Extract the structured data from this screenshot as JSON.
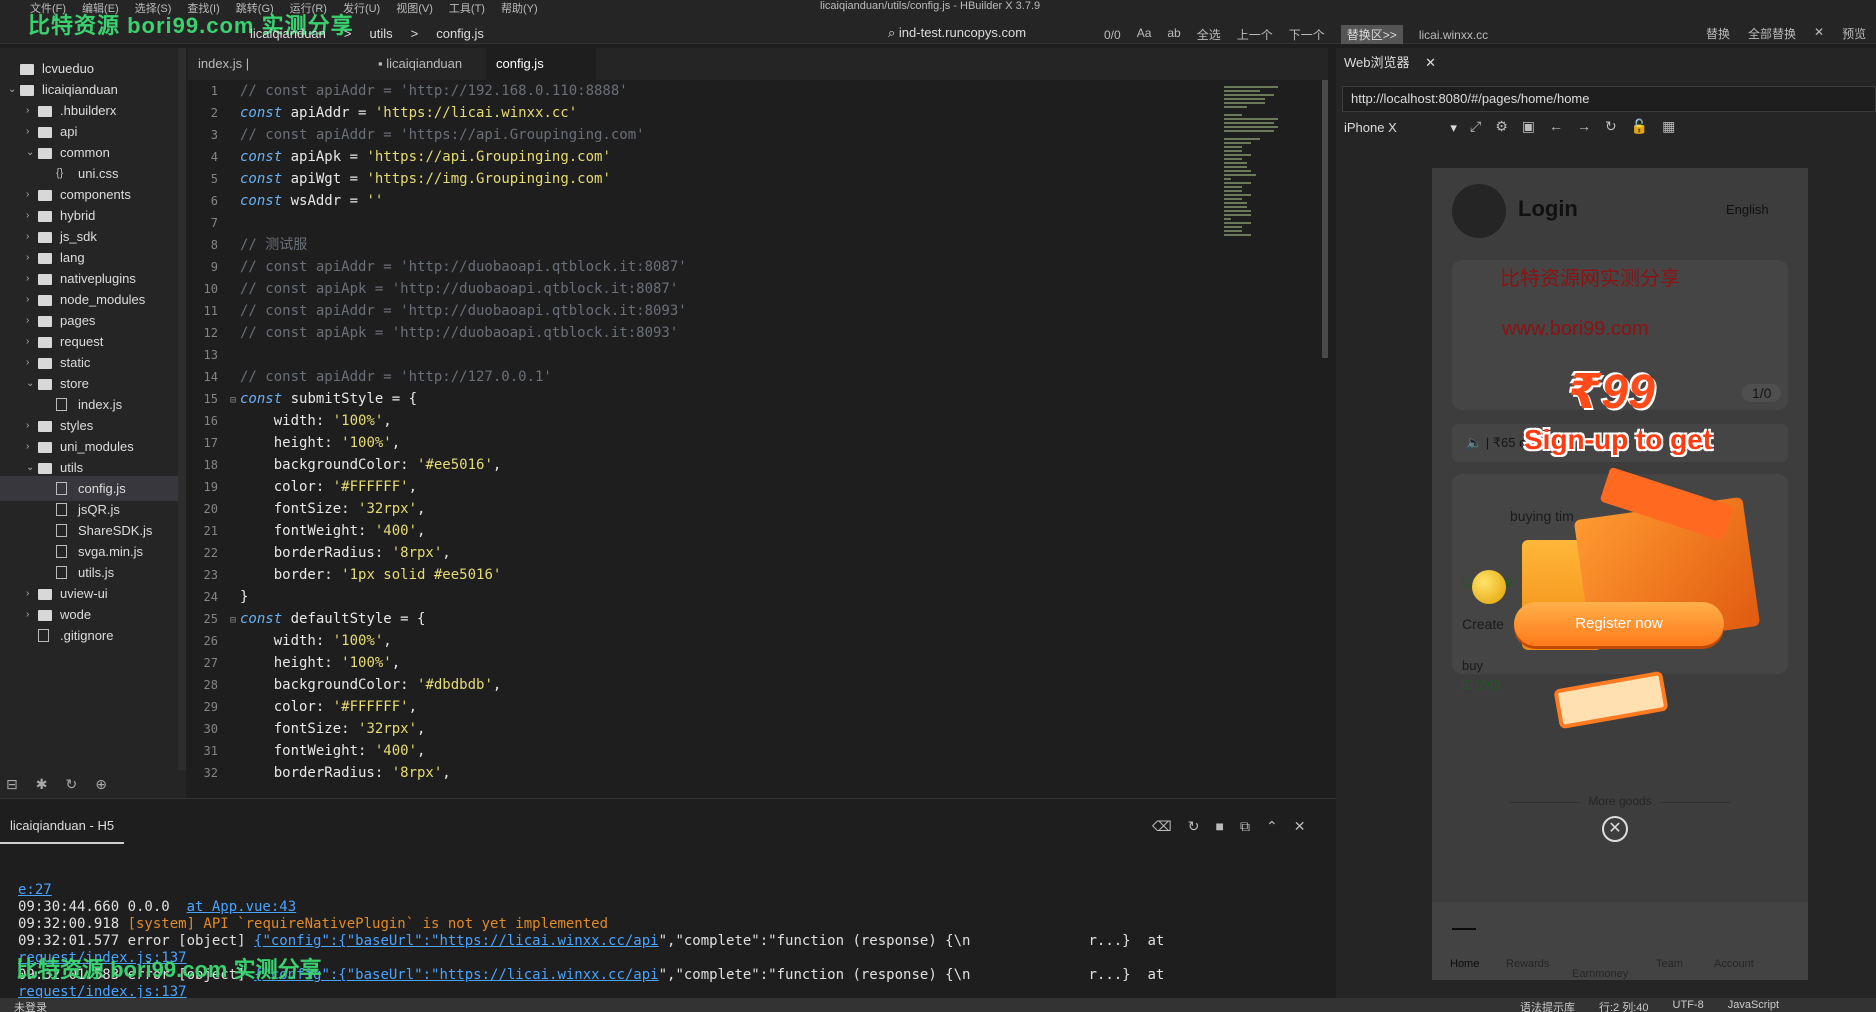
{
  "window": {
    "title": "licaiqianduan/utils/config.js - HBuilder X 3.7.9",
    "menu": [
      "文件(F)",
      "编辑(E)",
      "选择(S)",
      "查找(I)",
      "跳转(G)",
      "运行(R)",
      "发行(U)",
      "视图(V)",
      "工具(T)",
      "帮助(Y)"
    ]
  },
  "watermark": {
    "top": "比特资源 bori99.com 实测分享",
    "bottom": "比特资源 bori99.com 实测分享",
    "phone1": "比特资源网实测分享",
    "phone2": "www.bori99.com"
  },
  "toolbar": {
    "crumb": [
      "licaiqianduan",
      ">",
      "utils",
      ">",
      "config.js"
    ],
    "search_text": "ind-test.runcopys.com",
    "count": "0/0",
    "find_tools": [
      "Aa",
      "ab",
      "全选",
      "上一个",
      "下一个"
    ],
    "replace_tag": "替换区>>",
    "replace_value": "licai.winxx.cc",
    "replace_tools": [
      "替换",
      "全部替换",
      "✕",
      "预览"
    ]
  },
  "sidebar": {
    "items": [
      {
        "label": "lcvueduo",
        "type": "folder",
        "depth": 0,
        "chev": ""
      },
      {
        "label": "licaiqianduan",
        "type": "folder",
        "depth": 0,
        "chev": "⌄"
      },
      {
        "label": ".hbuilderx",
        "type": "folder",
        "depth": 1,
        "chev": "›"
      },
      {
        "label": "api",
        "type": "folder",
        "depth": 1,
        "chev": "›"
      },
      {
        "label": "common",
        "type": "folder",
        "depth": 1,
        "chev": "⌄"
      },
      {
        "label": "uni.css",
        "type": "css",
        "depth": 2,
        "chev": ""
      },
      {
        "label": "components",
        "type": "folder",
        "depth": 1,
        "chev": "›"
      },
      {
        "label": "hybrid",
        "type": "folder",
        "depth": 1,
        "chev": "›"
      },
      {
        "label": "js_sdk",
        "type": "folder",
        "depth": 1,
        "chev": "›"
      },
      {
        "label": "lang",
        "type": "folder",
        "depth": 1,
        "chev": "›"
      },
      {
        "label": "nativeplugins",
        "type": "folder",
        "depth": 1,
        "chev": "›"
      },
      {
        "label": "node_modules",
        "type": "folder",
        "depth": 1,
        "chev": "›"
      },
      {
        "label": "pages",
        "type": "folder",
        "depth": 1,
        "chev": "›"
      },
      {
        "label": "request",
        "type": "folder",
        "depth": 1,
        "chev": "›"
      },
      {
        "label": "static",
        "type": "folder",
        "depth": 1,
        "chev": "›"
      },
      {
        "label": "store",
        "type": "folder",
        "depth": 1,
        "chev": "⌄"
      },
      {
        "label": "index.js",
        "type": "file",
        "depth": 2,
        "chev": ""
      },
      {
        "label": "styles",
        "type": "folder",
        "depth": 1,
        "chev": "›"
      },
      {
        "label": "uni_modules",
        "type": "folder",
        "depth": 1,
        "chev": "›"
      },
      {
        "label": "utils",
        "type": "folder",
        "depth": 1,
        "chev": "⌄"
      },
      {
        "label": "config.js",
        "type": "file",
        "depth": 2,
        "chev": "",
        "active": true
      },
      {
        "label": "jsQR.js",
        "type": "file",
        "depth": 2,
        "chev": ""
      },
      {
        "label": "ShareSDK.js",
        "type": "file",
        "depth": 2,
        "chev": ""
      },
      {
        "label": "svga.min.js",
        "type": "file",
        "depth": 2,
        "chev": ""
      },
      {
        "label": "utils.js",
        "type": "file",
        "depth": 2,
        "chev": ""
      },
      {
        "label": "uview-ui",
        "type": "folder",
        "depth": 1,
        "chev": "›"
      },
      {
        "label": "wode",
        "type": "folder",
        "depth": 1,
        "chev": "›"
      },
      {
        "label": ".gitignore",
        "type": "file",
        "depth": 1,
        "chev": ""
      }
    ]
  },
  "tabs": [
    {
      "label": "index.js | lcvueduo/src/interface",
      "active": false
    },
    {
      "label": "licaiqianduan",
      "active": false
    },
    {
      "label": "config.js",
      "active": true
    }
  ],
  "code": [
    {
      "n": "1",
      "fold": "",
      "parts": [
        [
          "cmt",
          "// const apiAddr = 'http://192.168.0.110:8888'"
        ]
      ]
    },
    {
      "n": "2",
      "fold": "",
      "parts": [
        [
          "kw",
          "const"
        ],
        [
          "var",
          " apiAddr "
        ],
        [
          "op",
          "= "
        ],
        [
          "str",
          "'https://licai.winxx.cc'"
        ]
      ]
    },
    {
      "n": "3",
      "fold": "",
      "parts": [
        [
          "cmt",
          "// const apiAddr = 'https://api.Groupinging.com'"
        ]
      ]
    },
    {
      "n": "4",
      "fold": "",
      "parts": [
        [
          "kw",
          "const"
        ],
        [
          "var",
          " apiApk "
        ],
        [
          "op",
          "= "
        ],
        [
          "str",
          "'https://api.Groupinging.com'"
        ]
      ]
    },
    {
      "n": "5",
      "fold": "",
      "parts": [
        [
          "kw",
          "const"
        ],
        [
          "var",
          " apiWgt "
        ],
        [
          "op",
          "= "
        ],
        [
          "str",
          "'https://img.Groupinging.com'"
        ]
      ]
    },
    {
      "n": "6",
      "fold": "",
      "parts": [
        [
          "kw",
          "const"
        ],
        [
          "var",
          " wsAddr "
        ],
        [
          "op",
          "= "
        ],
        [
          "str",
          "''"
        ]
      ]
    },
    {
      "n": "7",
      "fold": "",
      "parts": []
    },
    {
      "n": "8",
      "fold": "",
      "parts": [
        [
          "cmt",
          "// 测试服"
        ]
      ]
    },
    {
      "n": "9",
      "fold": "",
      "parts": [
        [
          "cmt",
          "// const apiAddr = 'http://duobaoapi.qtblock.it:8087'"
        ]
      ]
    },
    {
      "n": "10",
      "fold": "",
      "parts": [
        [
          "cmt",
          "// const apiApk = 'http://duobaoapi.qtblock.it:8087'"
        ]
      ]
    },
    {
      "n": "11",
      "fold": "",
      "parts": [
        [
          "cmt",
          "// const apiAddr = 'http://duobaoapi.qtblock.it:8093'"
        ]
      ]
    },
    {
      "n": "12",
      "fold": "",
      "parts": [
        [
          "cmt",
          "// const apiApk = 'http://duobaoapi.qtblock.it:8093'"
        ]
      ]
    },
    {
      "n": "13",
      "fold": "",
      "parts": []
    },
    {
      "n": "14",
      "fold": "",
      "parts": [
        [
          "cmt",
          "// const apiAddr = 'http://127.0.0.1'"
        ]
      ]
    },
    {
      "n": "15",
      "fold": "⊟",
      "parts": [
        [
          "kw",
          "const"
        ],
        [
          "var",
          " submitStyle "
        ],
        [
          "op",
          "= {"
        ]
      ]
    },
    {
      "n": "16",
      "fold": "",
      "parts": [
        [
          "var",
          "    width: "
        ],
        [
          "str",
          "'100%'"
        ],
        [
          "op",
          ","
        ]
      ]
    },
    {
      "n": "17",
      "fold": "",
      "parts": [
        [
          "var",
          "    height: "
        ],
        [
          "str",
          "'100%'"
        ],
        [
          "op",
          ","
        ]
      ]
    },
    {
      "n": "18",
      "fold": "",
      "parts": [
        [
          "var",
          "    backgroundColor: "
        ],
        [
          "str",
          "'#ee5016'"
        ],
        [
          "op",
          ","
        ]
      ]
    },
    {
      "n": "19",
      "fold": "",
      "parts": [
        [
          "var",
          "    color: "
        ],
        [
          "str",
          "'#FFFFFF'"
        ],
        [
          "op",
          ","
        ]
      ]
    },
    {
      "n": "20",
      "fold": "",
      "parts": [
        [
          "var",
          "    fontSize: "
        ],
        [
          "str",
          "'32rpx'"
        ],
        [
          "op",
          ","
        ]
      ]
    },
    {
      "n": "21",
      "fold": "",
      "parts": [
        [
          "var",
          "    fontWeight: "
        ],
        [
          "str",
          "'400'"
        ],
        [
          "op",
          ","
        ]
      ]
    },
    {
      "n": "22",
      "fold": "",
      "parts": [
        [
          "var",
          "    borderRadius: "
        ],
        [
          "str",
          "'8rpx'"
        ],
        [
          "op",
          ","
        ]
      ]
    },
    {
      "n": "23",
      "fold": "",
      "parts": [
        [
          "var",
          "    border: "
        ],
        [
          "str",
          "'1px solid #ee5016'"
        ]
      ]
    },
    {
      "n": "24",
      "fold": "",
      "parts": [
        [
          "op",
          "}"
        ]
      ]
    },
    {
      "n": "25",
      "fold": "⊟",
      "parts": [
        [
          "kw",
          "const"
        ],
        [
          "var",
          " defaultStyle "
        ],
        [
          "op",
          "= {"
        ]
      ]
    },
    {
      "n": "26",
      "fold": "",
      "parts": [
        [
          "var",
          "    width: "
        ],
        [
          "str",
          "'100%'"
        ],
        [
          "op",
          ","
        ]
      ]
    },
    {
      "n": "27",
      "fold": "",
      "parts": [
        [
          "var",
          "    height: "
        ],
        [
          "str",
          "'100%'"
        ],
        [
          "op",
          ","
        ]
      ]
    },
    {
      "n": "28",
      "fold": "",
      "parts": [
        [
          "var",
          "    backgroundColor: "
        ],
        [
          "str",
          "'#dbdbdb'"
        ],
        [
          "op",
          ","
        ]
      ]
    },
    {
      "n": "29",
      "fold": "",
      "parts": [
        [
          "var",
          "    color: "
        ],
        [
          "str",
          "'#FFFFFF'"
        ],
        [
          "op",
          ","
        ]
      ]
    },
    {
      "n": "30",
      "fold": "",
      "parts": [
        [
          "var",
          "    fontSize: "
        ],
        [
          "str",
          "'32rpx'"
        ],
        [
          "op",
          ","
        ]
      ]
    },
    {
      "n": "31",
      "fold": "",
      "parts": [
        [
          "var",
          "    fontWeight: "
        ],
        [
          "str",
          "'400'"
        ],
        [
          "op",
          ","
        ]
      ]
    },
    {
      "n": "32",
      "fold": "",
      "parts": [
        [
          "var",
          "    borderRadius: "
        ],
        [
          "str",
          "'8rpx'"
        ],
        [
          "op",
          ","
        ]
      ]
    }
  ],
  "browser": {
    "tab_label": "Web浏览器",
    "url": "http://localhost:8080/#/pages/home/home",
    "device": "iPhone X"
  },
  "phone": {
    "login_title": "Login",
    "lang": "English",
    "pager": "1/0",
    "notice": "🔈 | ₹65            ed ₹50...",
    "price": "₹99",
    "signup": "Sign-up to get",
    "register": "Register now",
    "goods_text1": "buying tim",
    "goods_text2": "Create",
    "goods_text3": "buy",
    "goods_count": "☑ (0/0)",
    "goods_count2": "☑ (₹0/₹0",
    "more_goods": "More goods",
    "tabbar": [
      "Home",
      "Rewards",
      "Earnmoney",
      "Team",
      "Account"
    ]
  },
  "console": {
    "title": "licaiqianduan - H5",
    "lines": [
      {
        "pre": "",
        "link": "e:27",
        "post": "",
        "warn": ""
      },
      {
        "pre": "09:30:44.660 0.0.0  ",
        "link": "at App.vue:43",
        "post": "",
        "warn": ""
      },
      {
        "pre": "09:32:00.918 ",
        "link": "",
        "post": "",
        "warn": "[system] API `requireNativePlugin` is not yet implemented"
      },
      {
        "pre": "09:32:01.577 error [object] ",
        "link": "{\"config\":{\"baseUrl\":\"https://licai.winxx.cc/api",
        "post": "\",\"complete\":\"function (response) {\\n              r...}  at",
        "warn": ""
      },
      {
        "pre": "",
        "link": "request/index.js:137",
        "post": "",
        "warn": ""
      },
      {
        "pre": "09:32:01.583 error [object] ",
        "link": "{\"config\":{\"baseUrl\":\"https://licai.winxx.cc/api",
        "post": "\",\"complete\":\"function (response) {\\n              r...}  at",
        "warn": ""
      },
      {
        "pre": "",
        "link": "request/index.js:137",
        "post": "",
        "warn": ""
      }
    ]
  },
  "status": {
    "left": "未登录",
    "right": [
      "语法提示库",
      "行:2  列:40",
      "UTF-8",
      "JavaScript"
    ]
  }
}
